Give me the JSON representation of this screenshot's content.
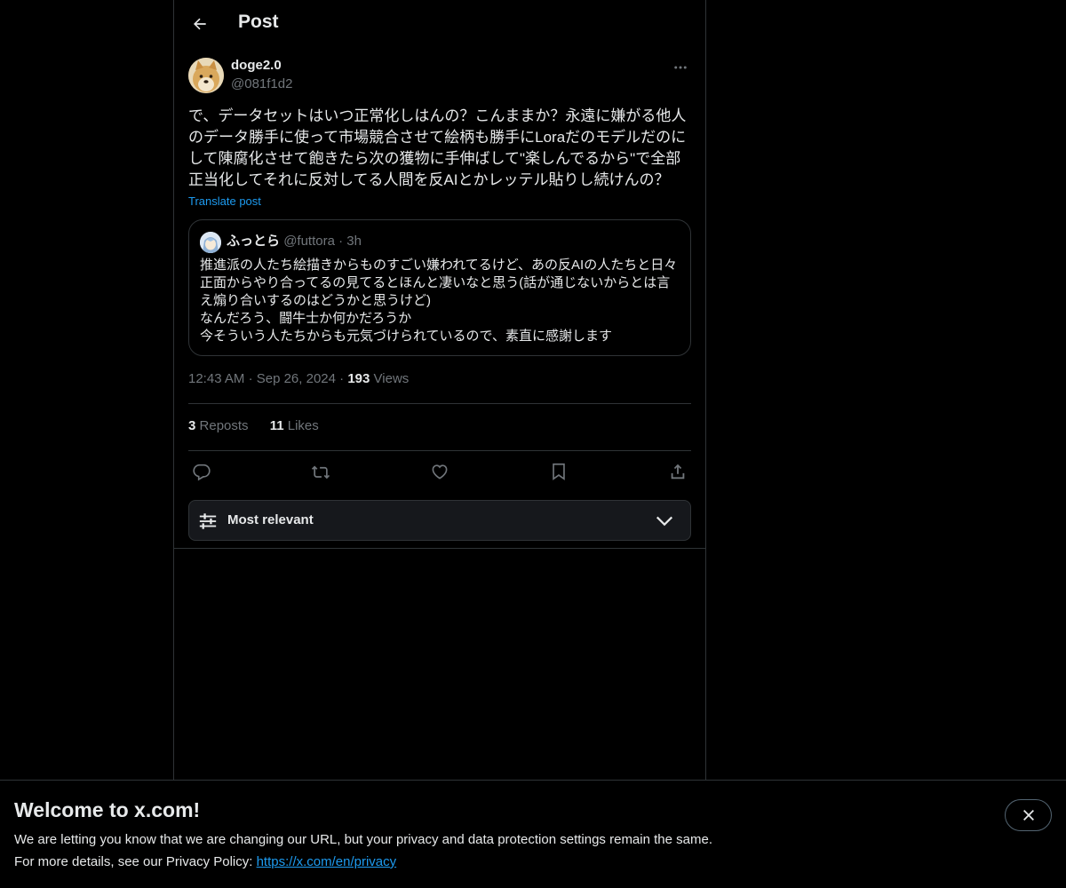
{
  "header": {
    "title": "Post",
    "back_icon": "arrow-left-icon"
  },
  "post": {
    "author_name": "doge2.0",
    "author_handle": "@081f1d2",
    "text": "で、データセットはいつ正常化しはんの？こんままか？永遠に嫌がる他人のデータ勝手に使って市場競合させて絵柄も勝手にLoraだのモデルだのにして陳腐化させて飽きたら次の獲物に手伸ばして\"楽しんでるから\"で全部正当化してそれに反対してる人間を反AIとかレッテル貼りし続けんの？",
    "translate_label": "Translate post",
    "time": "12:43 AM",
    "date": "Sep 26, 2024",
    "sep": "·",
    "views_count": "193",
    "views_label": "Views",
    "reposts_count": "3",
    "reposts_label": "Reposts",
    "likes_count": "11",
    "likes_label": "Likes"
  },
  "quote": {
    "author_name": "ふっとら",
    "author_handle": "@futtora",
    "sep": "·",
    "time": "3h",
    "text": "推進派の人たち絵描きからものすごい嫌われてるけど、あの反AIの人たちと日々正面からやり合ってるの見てるとほんと凄いなと思う(話が通じないからとは言え煽り合いするのはどうかと思うけど)\nなんだろう、闘牛士か何かだろうか\n今そういう人たちからも元気づけられているので、素直に感謝します"
  },
  "actions": {
    "reply_icon": "reply-icon",
    "repost_icon": "repost-icon",
    "like_icon": "heart-icon",
    "bookmark_icon": "bookmark-icon",
    "share_icon": "share-icon"
  },
  "sort": {
    "label": "Most relevant"
  },
  "banner": {
    "title": "Welcome to x.com!",
    "line1": "We are letting you know that we are changing our URL, but your privacy and data protection settings remain the same.",
    "line2_prefix": "For more details, see our Privacy Policy: ",
    "link": "https://x.com/en/privacy"
  },
  "colors": {
    "background": "#000000",
    "text": "#e7e9ea",
    "muted": "#71767b",
    "accent": "#1d9bf0",
    "border": "#2f3336"
  }
}
